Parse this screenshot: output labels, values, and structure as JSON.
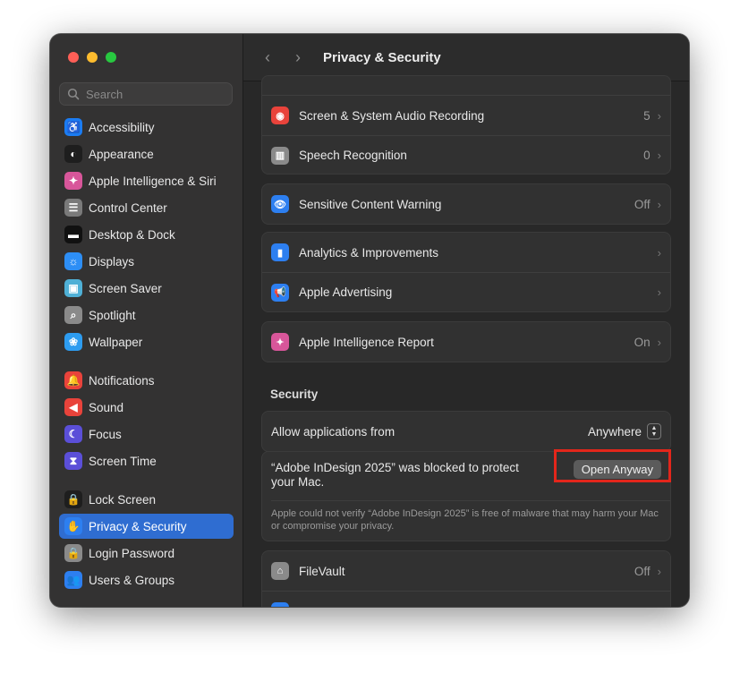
{
  "window": {
    "title": "Privacy & Security"
  },
  "search": {
    "placeholder": "Search"
  },
  "sidebar": {
    "items": [
      {
        "label": "Accessibility",
        "icon": "accessibility-icon",
        "color": "#1b7cf2",
        "glyph": "♿"
      },
      {
        "label": "Appearance",
        "icon": "appearance-icon",
        "color": "#1e1e1e",
        "glyph": "◐"
      },
      {
        "label": "Apple Intelligence & Siri",
        "icon": "siri-icon",
        "color": "#d8569a",
        "glyph": "✦"
      },
      {
        "label": "Control Center",
        "icon": "control-center-icon",
        "color": "#7a7a7a",
        "glyph": "☰"
      },
      {
        "label": "Desktop & Dock",
        "icon": "dock-icon",
        "color": "#111111",
        "glyph": "▬"
      },
      {
        "label": "Displays",
        "icon": "displays-icon",
        "color": "#2d8ef5",
        "glyph": "☼"
      },
      {
        "label": "Screen Saver",
        "icon": "screen-saver-icon",
        "color": "#4fb0d6",
        "glyph": "▣"
      },
      {
        "label": "Spotlight",
        "icon": "spotlight-icon",
        "color": "#8a8a8a",
        "glyph": "⌕"
      },
      {
        "label": "Wallpaper",
        "icon": "wallpaper-icon",
        "color": "#2d9cf0",
        "glyph": "❀"
      },
      {
        "label": "Notifications",
        "icon": "notifications-icon",
        "color": "#e9433b",
        "glyph": "🔔"
      },
      {
        "label": "Sound",
        "icon": "sound-icon",
        "color": "#e9433b",
        "glyph": "◀"
      },
      {
        "label": "Focus",
        "icon": "focus-icon",
        "color": "#5b4fd8",
        "glyph": "☾"
      },
      {
        "label": "Screen Time",
        "icon": "screen-time-icon",
        "color": "#5b4fd8",
        "glyph": "⧗"
      },
      {
        "label": "Lock Screen",
        "icon": "lock-screen-icon",
        "color": "#1e1e1e",
        "glyph": "🔒"
      },
      {
        "label": "Privacy & Security",
        "icon": "privacy-hand-icon",
        "color": "#2d7ff0",
        "glyph": "✋"
      },
      {
        "label": "Login Password",
        "icon": "login-password-icon",
        "color": "#8a8a8a",
        "glyph": "🔒"
      },
      {
        "label": "Users & Groups",
        "icon": "users-groups-icon",
        "color": "#2d7ff0",
        "glyph": "👥"
      }
    ],
    "active": "Privacy & Security"
  },
  "main": {
    "group1": [
      {
        "label": "Screen & System Audio Recording",
        "value": "5",
        "icon": "screen-recording-icon",
        "color": "#e9433b",
        "glyph": "◉"
      },
      {
        "label": "Speech Recognition",
        "value": "0",
        "icon": "speech-recognition-icon",
        "color": "#8a8a8a",
        "glyph": "▥"
      }
    ],
    "group2": [
      {
        "label": "Sensitive Content Warning",
        "value": "Off",
        "icon": "sensitive-content-icon",
        "color": "#2d7ff0",
        "glyph": "👁"
      }
    ],
    "group3": [
      {
        "label": "Analytics & Improvements",
        "value": "",
        "icon": "analytics-icon",
        "color": "#2d7ff0",
        "glyph": "▮"
      },
      {
        "label": "Apple Advertising",
        "value": "",
        "icon": "advertising-icon",
        "color": "#2d7ff0",
        "glyph": "📢"
      }
    ],
    "group4": [
      {
        "label": "Apple Intelligence Report",
        "value": "On",
        "icon": "intelligence-report-icon",
        "color": "#d8569a",
        "glyph": "✦"
      }
    ],
    "security_title": "Security",
    "allow_apps": {
      "label": "Allow applications from",
      "value": "Anywhere"
    },
    "blocked": {
      "message": "“Adobe InDesign 2025” was blocked to protect your Mac.",
      "button": "Open Anyway",
      "detail": "Apple could not verify “Adobe InDesign 2025” is free of malware that may harm your Mac or compromise your privacy."
    },
    "filevault": {
      "label": "FileVault",
      "value": "Off",
      "icon": "filevault-icon",
      "color": "#8a8a8a",
      "glyph": "⌂"
    },
    "highlight_color": "#e3261b",
    "accent_color": "#2f6dd1"
  }
}
